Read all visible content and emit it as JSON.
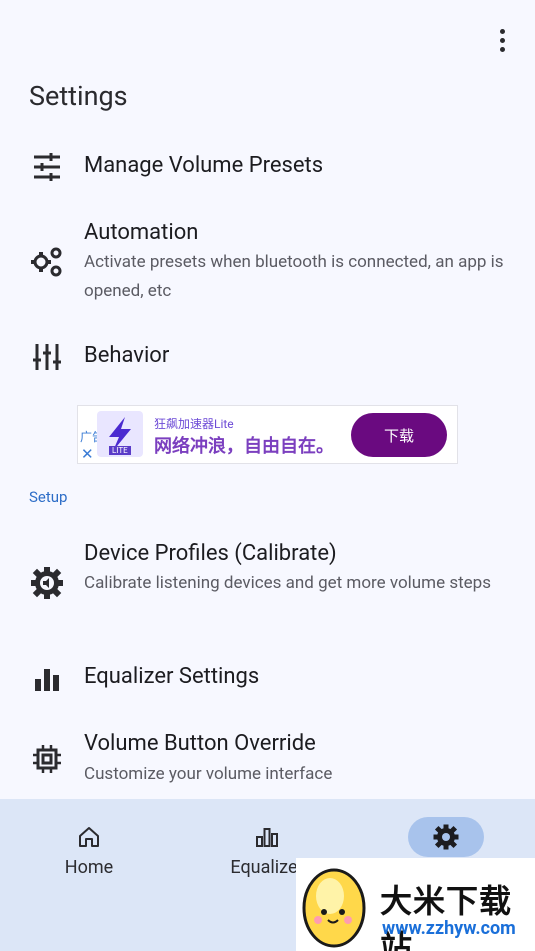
{
  "app": {
    "title": "Settings",
    "overflow_menu": "more-vert-icon"
  },
  "items": [
    {
      "icon": "sliders-icon",
      "title": "Manage Volume Presets"
    },
    {
      "icon": "gears-icon",
      "title": "Automation",
      "subtitle": "Activate presets when bluetooth is connected, an app is opened, etc"
    },
    {
      "icon": "tune-vertical-icon",
      "title": "Behavior"
    }
  ],
  "ad": {
    "label": "广告",
    "close": "✕",
    "logo_text": "LITE",
    "name": "狂飙加速器Lite",
    "slogan": "网络冲浪，自由自在。",
    "button": "下载"
  },
  "setup": {
    "header": "Setup",
    "items": [
      {
        "icon": "settings-cog-icon",
        "title": "Device Profiles (Calibrate)",
        "subtitle": "Calibrate listening devices and get more volume steps"
      },
      {
        "icon": "bar-chart-icon",
        "title": "Equalizer Settings"
      },
      {
        "icon": "chip-icon",
        "title": "Volume Button Override",
        "subtitle": "Customize your volume interface"
      }
    ]
  },
  "nav": [
    {
      "icon": "home-icon",
      "label": "Home",
      "active": false
    },
    {
      "icon": "equalizer-icon",
      "label": "Equalizer",
      "active": false
    },
    {
      "icon": "gear-icon",
      "label": "",
      "active": true
    }
  ],
  "watermark": {
    "title": "大米下载站",
    "url": "www.zzhyw.com"
  },
  "colors": {
    "background": "#f7f8ff",
    "nav_background": "#dce6f7",
    "nav_active_pill": "#a8c3ec",
    "section_header": "#2d6dc7",
    "ad_button": "#6a0a80"
  }
}
